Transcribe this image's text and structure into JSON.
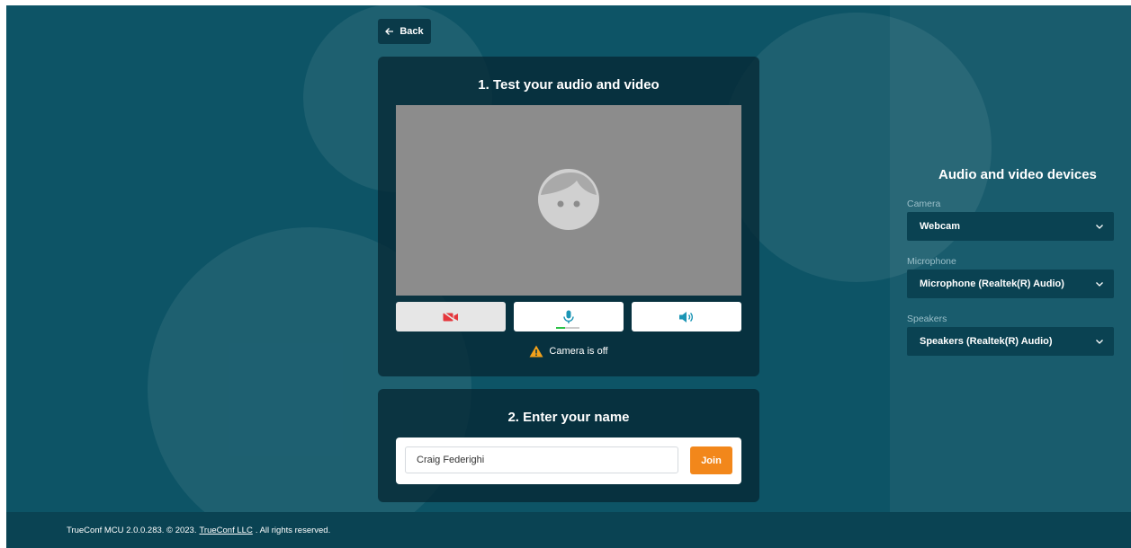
{
  "header": {
    "back_label": "Back"
  },
  "test_card": {
    "title": "1. Test your audio and video",
    "status_text": "Camera is off",
    "mic_level": 0.4
  },
  "name_card": {
    "title": "2. Enter your name",
    "name_value": "Craig Federighi",
    "join_label": "Join"
  },
  "devices": {
    "title": "Audio and video devices",
    "camera": {
      "label": "Camera",
      "value": "Webcam"
    },
    "microphone": {
      "label": "Microphone",
      "value": "Microphone (Realtek(R) Audio)"
    },
    "speakers": {
      "label": "Speakers",
      "value": "Speakers (Realtek(R) Audio)"
    }
  },
  "footer": {
    "prefix": "TrueConf MCU 2.0.0.283. © 2023.",
    "link": "TrueConf LLC",
    "suffix": ". All rights reserved."
  },
  "colors": {
    "background": "#0d5466",
    "accent_orange": "#f2871b",
    "camera_off_red": "#e5363c",
    "icon_teal": "#1b95b5",
    "mic_level_green": "#2bc246"
  },
  "icons": [
    "arrow-left-icon",
    "avatar-placeholder-icon",
    "camera-off-icon",
    "microphone-icon",
    "speaker-icon",
    "warning-icon",
    "chevron-down-icon"
  ]
}
